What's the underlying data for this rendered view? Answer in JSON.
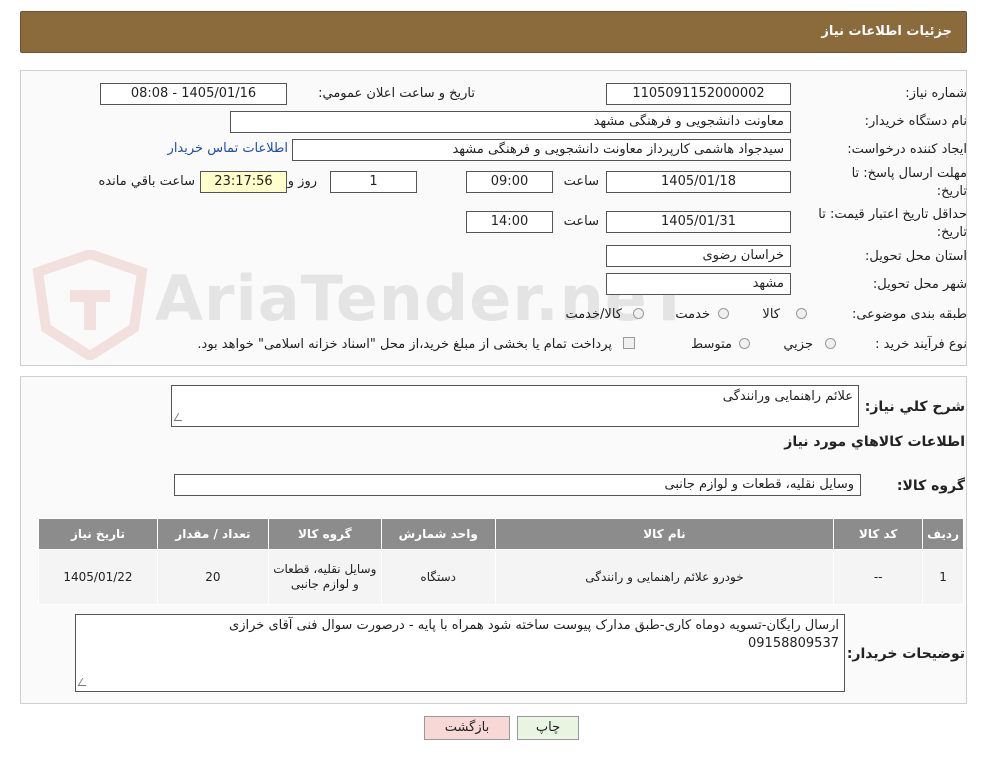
{
  "header": {
    "title": "جزئیات اطلاعات نیاز"
  },
  "form": {
    "need_number_label": "شماره نیاز:",
    "need_number": "1105091152000002",
    "announce_label": "تاریخ و ساعت اعلان عمومي:",
    "announce_value": "1405/01/16 - 08:08",
    "buyer_org_label": "نام دستگاه خریدار:",
    "buyer_org": "معاونت دانشجویی و فرهنگی مشهد",
    "requester_label": "ایجاد کننده درخواست:",
    "requester": "سیدجواد هاشمی کارپرداز معاونت دانشجویی و فرهنگی مشهد",
    "contact_link": "اطلاعات تماس خریدار",
    "deadline_label_1": "مهلت ارسال پاسخ: تا",
    "deadline_label_2": "تاریخ:",
    "deadline_date": "1405/01/18",
    "hour_label": "ساعت",
    "deadline_time": "09:00",
    "days_value": "1",
    "days_label": "روز و",
    "remaining_time": "23:17:56",
    "remaining_label": "ساعت باقي مانده",
    "validity_label_1": "حداقل تاریخ اعتبار قیمت: تا",
    "validity_label_2": "تاریخ:",
    "validity_date": "1405/01/31",
    "validity_time": "14:00",
    "province_label": "استان محل تحویل:",
    "province": "خراسان رضوی",
    "city_label": "شهر محل تحویل:",
    "city": "مشهد",
    "category_label": "طبقه بندی موضوعی:",
    "category_options": [
      "کالا",
      "خدمت",
      "کالا/خدمت"
    ],
    "process_label": "نوع فرآیند خرید :",
    "process_options": [
      "جزیي",
      "متوسط"
    ],
    "treasury_note": "پرداخت تمام یا بخشی از مبلغ خرید،از محل \"اسناد خزانه اسلامی\" خواهد بود."
  },
  "summary": {
    "label": "شرح کلي نیاز:",
    "value": "علائم راهنمایی ورانندگی"
  },
  "goods": {
    "section_title": "اطلاعات کالاهاي مورد نیاز",
    "group_label": "گروه کالا:",
    "group_value": "وسایل نقلیه، قطعات و لوازم جانبی",
    "columns": [
      "ردیف",
      "کد کالا",
      "نام کالا",
      "واحد شمارش",
      "گروه کالا",
      "تعداد / مقدار",
      "تاریخ نیاز"
    ],
    "rows": [
      [
        "1",
        "--",
        "خودرو علائم راهنمایی و رانندگی",
        "دستگاه",
        "وسایل نقلیه، قطعات و لوازم جانبی",
        "20",
        "1405/01/22"
      ]
    ]
  },
  "buyer_notes": {
    "label": "توضیحات خریدار:",
    "line1": "ارسال رایگان-تسویه دوماه کاری-طبق مدارک پیوست ساخته شود همراه با پایه - درصورت سوال فنی آقای خرازی",
    "line2": "09158809537"
  },
  "buttons": {
    "print": "چاپ",
    "back": "بازگشت"
  },
  "watermark": {
    "text": "AriaTender.neT"
  },
  "colors": {
    "header": "#8b6a3c",
    "back_button": "#f8d7d7",
    "print_button": "#e8f5e0"
  }
}
